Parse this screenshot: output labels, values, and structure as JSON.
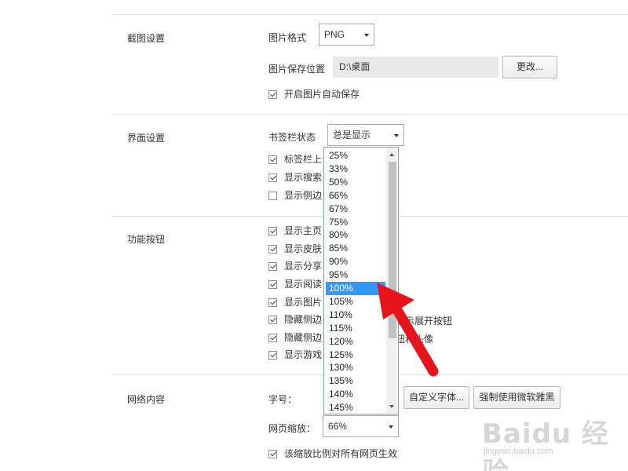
{
  "screenshot": {
    "title": "截图设置",
    "format_label": "图片格式",
    "format_value": "PNG",
    "save_location_label": "图片保存位置",
    "save_location_value": "D:\\桌面",
    "change_button": "更改...",
    "auto_save_label": "开启图片自动保存",
    "auto_save_checked": true
  },
  "interface": {
    "title": "界面设置",
    "tabbar_label": "书签栏状态",
    "tabbar_value": "总是显示",
    "options": [
      {
        "label": "标签栏上",
        "checked": true
      },
      {
        "label": "显示搜索",
        "checked": true
      },
      {
        "label": "显示侧边",
        "checked": false
      }
    ]
  },
  "function_buttons": {
    "title": "功能按钮",
    "options": [
      {
        "label": "显示主页",
        "checked": true
      },
      {
        "label": "显示皮肤",
        "checked": true
      },
      {
        "label": "显示分享",
        "checked": true
      },
      {
        "label": "显示阅读",
        "checked": true
      },
      {
        "label": "显示图片",
        "checked": true
      },
      {
        "label": "隐藏侧边",
        "suffix": "显示展开按钮",
        "checked": true
      },
      {
        "label": "隐藏侧边",
        "suffix": "钮和头像",
        "checked": true
      },
      {
        "label": "显示游戏",
        "checked": true
      }
    ]
  },
  "network": {
    "title": "网络内容",
    "font_size_label": "字号：",
    "custom_font_button": "自定义字体...",
    "force_font_button": "强制使用微软雅黑",
    "zoom_label": "网页缩放：",
    "zoom_value": "66%",
    "apply_all_label": "该缩放比例对所有网页生效",
    "apply_all_checked": true
  },
  "zoom_dropdown": {
    "options": [
      "25%",
      "33%",
      "50%",
      "66%",
      "67%",
      "75%",
      "80%",
      "85%",
      "90%",
      "95%",
      "100%",
      "105%",
      "110%",
      "115%",
      "120%",
      "125%",
      "130%",
      "135%",
      "140%",
      "145%"
    ],
    "highlighted": "100%"
  },
  "annotation": {
    "arrow_color": "#e8141c"
  },
  "watermark": {
    "main": "Baidu 经验",
    "sub": "jingyan.baidu.com"
  },
  "colors": {
    "selection": "#3399ff",
    "divider": "#e3e3e3"
  }
}
